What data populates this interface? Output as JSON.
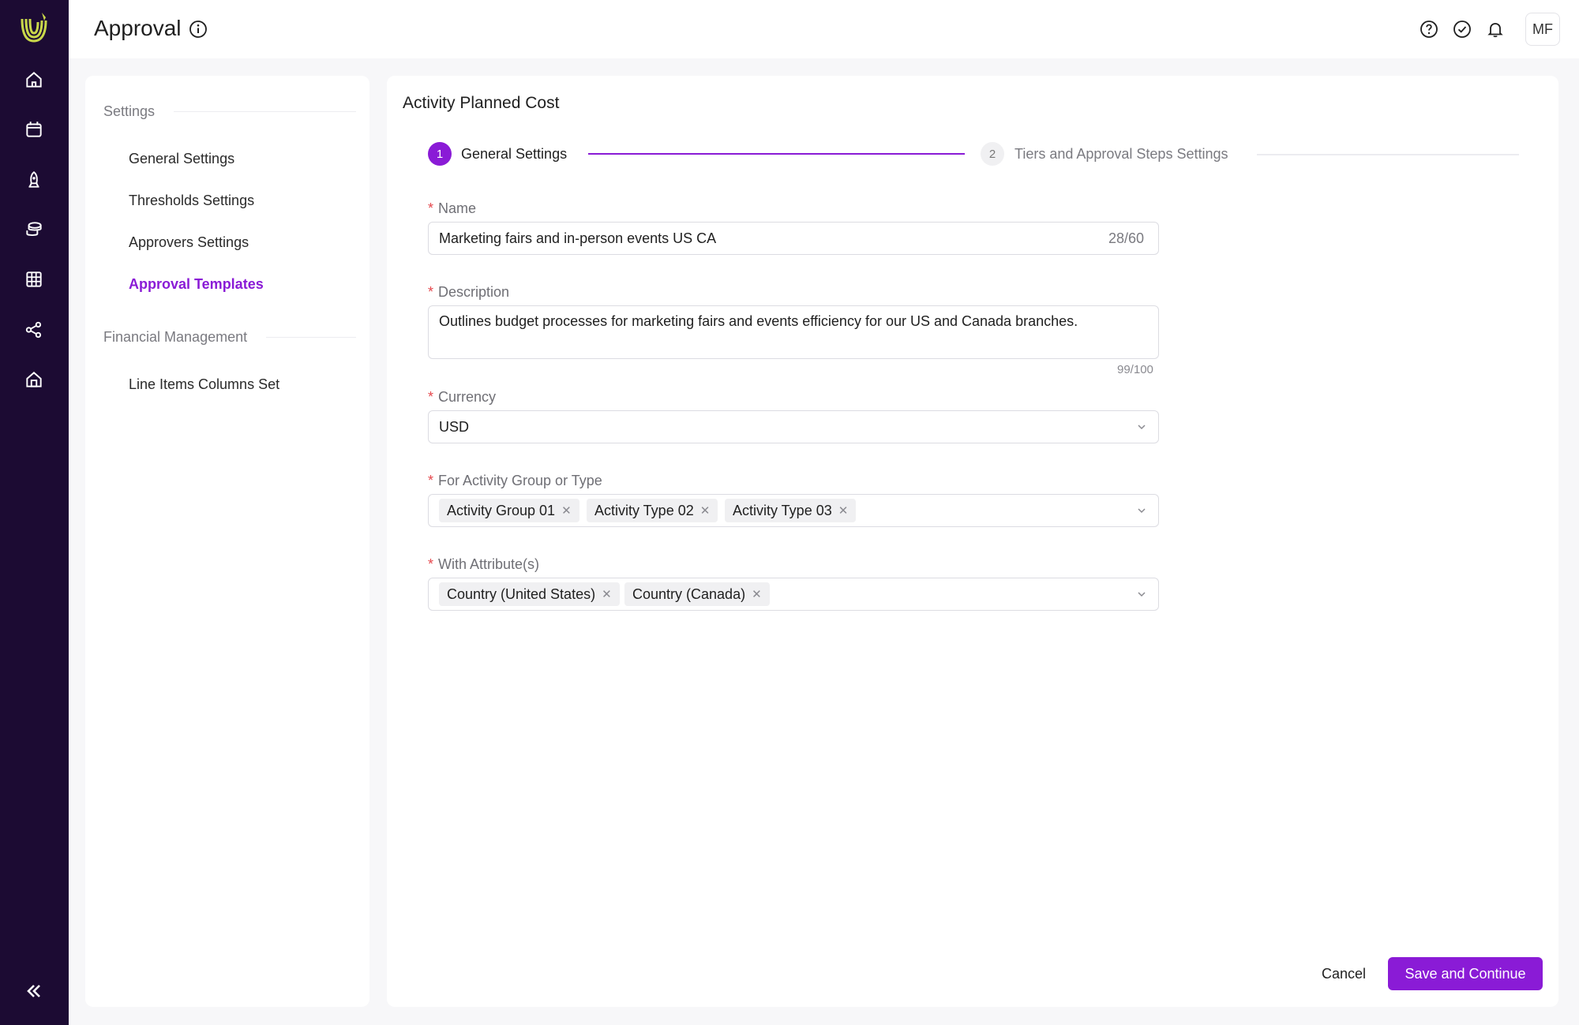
{
  "app": {
    "title": "Approval",
    "user_initials": "MF",
    "accent_color": "#8a1bd6",
    "rail_color": "#1c0b33",
    "rail_icons": [
      "home-icon",
      "calendar-icon",
      "rocket-icon",
      "coins-icon",
      "table-icon",
      "share-icon",
      "store-icon"
    ],
    "header_icons": [
      "help-icon",
      "check-circle-icon",
      "bell-icon"
    ]
  },
  "sidebar": {
    "groups": [
      {
        "title": "Settings",
        "items": [
          {
            "label": "General Settings",
            "active": false
          },
          {
            "label": "Thresholds Settings",
            "active": false
          },
          {
            "label": "Approvers Settings",
            "active": false
          },
          {
            "label": "Approval Templates",
            "active": true
          }
        ]
      },
      {
        "title": "Financial Management",
        "items": [
          {
            "label": "Line Items Columns Set",
            "active": false
          }
        ]
      }
    ]
  },
  "main": {
    "title": "Activity Planned Cost",
    "steps": [
      {
        "number": "1",
        "label": "General Settings",
        "status": "current"
      },
      {
        "number": "2",
        "label": "Tiers and Approval Steps Settings",
        "status": "pending"
      }
    ],
    "form": {
      "name": {
        "label": "Name",
        "value": "Marketing fairs and in-person events US CA",
        "counter": "28/60"
      },
      "description": {
        "label": "Description",
        "value": "Outlines budget processes for marketing fairs and events efficiency for our US and Canada branches.",
        "counter": "99/100"
      },
      "currency": {
        "label": "Currency",
        "value": "USD"
      },
      "activity_group": {
        "label": "For Activity Group or Type",
        "tags": [
          "Activity Group 01",
          "Activity Type 02",
          "Activity Type 03"
        ]
      },
      "attributes": {
        "label": "With Attribute(s)",
        "tags": [
          "Country (United States)",
          "Country (Canada)"
        ]
      }
    },
    "actions": {
      "cancel": "Cancel",
      "primary": "Save and Continue"
    }
  }
}
